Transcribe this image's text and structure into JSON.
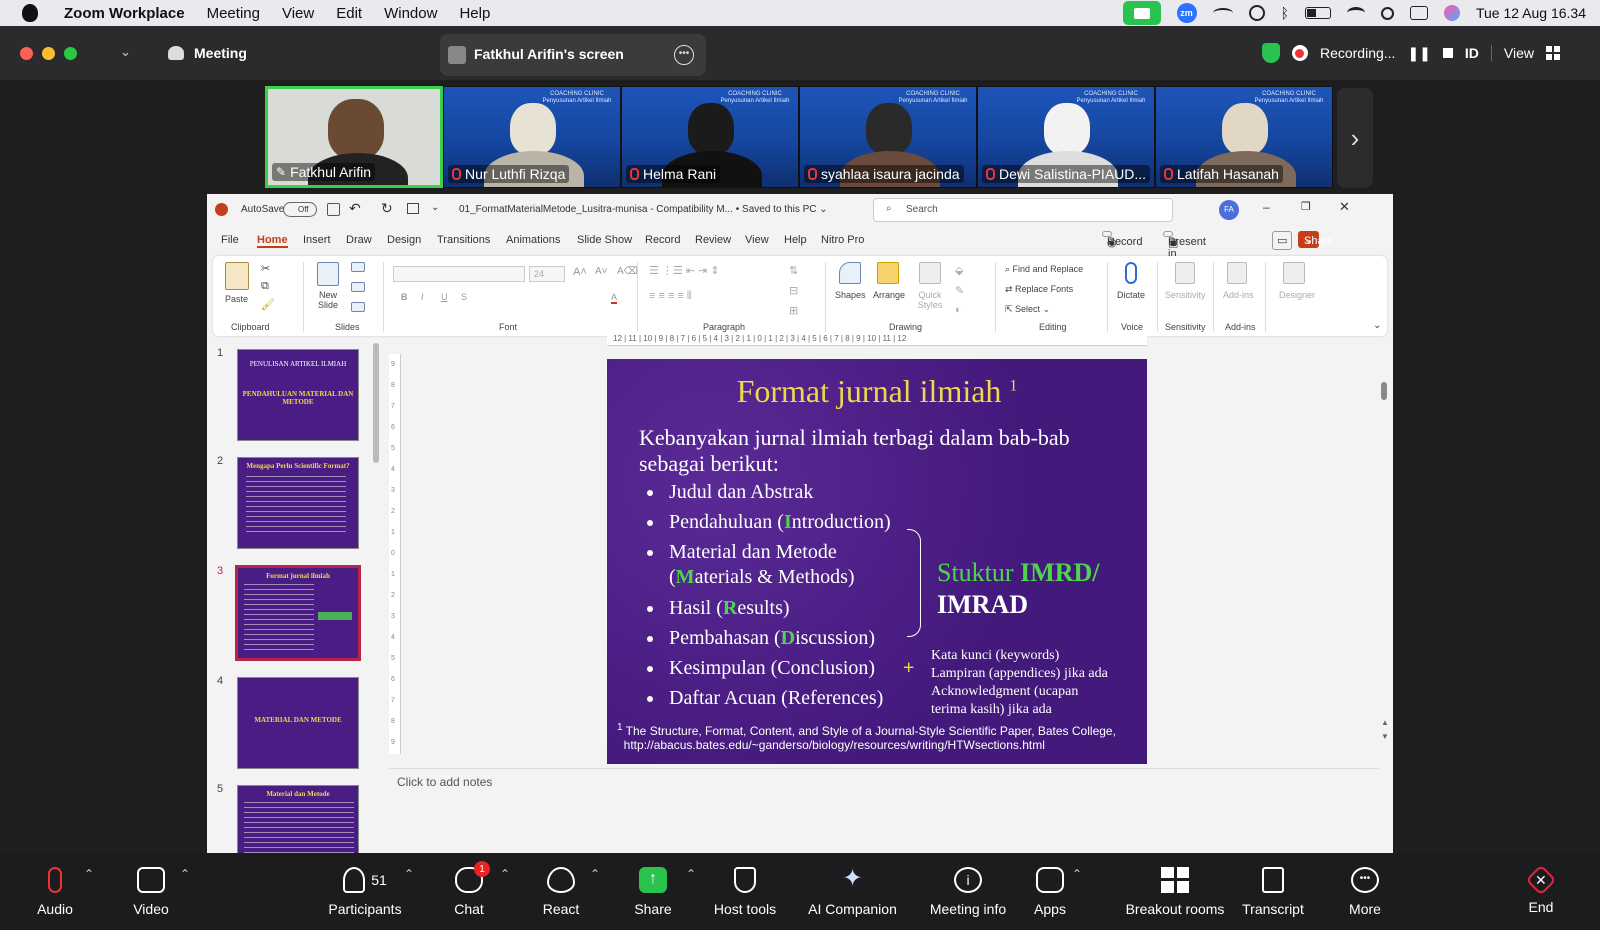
{
  "menubar": {
    "app": "Zoom Workplace",
    "items": [
      "Meeting",
      "View",
      "Edit",
      "Window",
      "Help"
    ],
    "clock": "Tue 12 Aug  16.34",
    "zoom_icon_text": "zm"
  },
  "titlebar": {
    "meeting_label": "Meeting",
    "share_title": "Fatkhul Arifin's screen",
    "recording": "Recording...",
    "id_label": "ID",
    "view_label": "View"
  },
  "participants_strip": {
    "banner_text": "COACHING CLINIC Penyusunan Artikel Ilmiah",
    "tiles": [
      "Fatkhul Arifin",
      "Nur Luthfi Rizqa",
      "Helma Rani",
      "syahlaa isaura jacinda",
      "Dewi Salistina-PIAUD...",
      "Latifah Hasanah"
    ],
    "next_arrow": "›"
  },
  "ppt": {
    "autosave": "AutoSave",
    "autosave_state": "Off",
    "doc_title": "01_FormatMaterialMetode_Lusitra-munisa  -  Compatibility M...  •  Saved to this PC ⌄",
    "search_placeholder": "Search",
    "avatar": "FA",
    "tabs": [
      "File",
      "Home",
      "Insert",
      "Draw",
      "Design",
      "Transitions",
      "Animations",
      "Slide Show",
      "Record",
      "Review",
      "View",
      "Help",
      "Nitro Pro"
    ],
    "record_btn": "Record",
    "present_btn": "Present in Teams",
    "share_btn": "Share",
    "ribbon": {
      "paste": "Paste",
      "new_slide": "New Slide",
      "clipboard": "Clipboard",
      "slides": "Slides",
      "font": "Font",
      "paragraph": "Paragraph",
      "shapes": "Shapes",
      "arrange": "Arrange",
      "quick_styles": "Quick Styles",
      "drawing": "Drawing",
      "find_replace": "Find and Replace",
      "replace_fonts": "Replace Fonts",
      "select": "Select",
      "editing": "Editing",
      "dictate": "Dictate",
      "voice": "Voice",
      "sensitivity": "Sensitivity",
      "addins": "Add-ins",
      "designer": "Designer",
      "font_size": "24",
      "bold": "B",
      "italic": "I",
      "underline": "U",
      "strike": "S",
      "font_color": "A"
    },
    "ruler_h": "12 | 11 | 10 | 9 | 8 | 7 | 6 | 5 | 4 | 3 | 2 | 1 | 0 | 1 | 2 | 3 | 4 | 5 | 6 | 7 | 8 | 9 | 10 | 11 | 12",
    "ruler_v": "9 8 7 6 5 4 3 2 1 0 1 2 3 4 5 6 7 8 9",
    "thumbnails": [
      {
        "num": "1",
        "title": "PENULISAN ARTIKEL ILMIAH",
        "sub": "PENDAHULUAN MATERIAL DAN METODE"
      },
      {
        "num": "2",
        "title": "Mengapa Perlu Scientific Format?",
        "sub": ""
      },
      {
        "num": "3",
        "title": "Format jurnal ilmiah",
        "sub": ""
      },
      {
        "num": "4",
        "title": "MATERIAL DAN METODE",
        "sub": ""
      },
      {
        "num": "5",
        "title": "Material dan Metode",
        "sub": ""
      }
    ],
    "slide": {
      "title": "Format jurnal ilmiah",
      "title_sup": "1",
      "intro": "Kebanyakan jurnal ilmiah terbagi dalam bab-bab sebagai berikut:",
      "bullets": [
        {
          "pre": "Judul dan Abstrak",
          "hl": "",
          "post": ""
        },
        {
          "pre": "Pendahuluan (",
          "hl": "I",
          "post": "ntroduction)"
        },
        {
          "pre": "Material dan Metode",
          "hl": "",
          "post": ""
        },
        {
          "pre": "(",
          "hl": "M",
          "post": "aterials & Methods)"
        },
        {
          "pre": "Hasil (",
          "hl": "R",
          "post": "esults)"
        },
        {
          "pre": "Pembahasan (",
          "hl": "D",
          "post": "iscussion)"
        },
        {
          "pre": "Kesimpulan (Conclusion)",
          "hl": "",
          "post": ""
        },
        {
          "pre": "Daftar Acuan (References)",
          "hl": "",
          "post": ""
        }
      ],
      "imrd_pre": "Stuktur ",
      "imrd_hl": "IMRD/",
      "imrd_line2": "IMRAD",
      "plus": "+",
      "extra": [
        "Kata kunci (keywords)",
        "Lampiran (appendices) jika ada",
        "Acknowledgment (ucapan",
        "terima kasih) jika ada"
      ],
      "foot_sup": "1",
      "foot1": " The Structure, Format, Content, and Style of a Journal-Style Scientific Paper, Bates College,",
      "foot2": "http://abacus.bates.edu/~ganderso/biology/resources/writing/HTWsections.html"
    },
    "notes": "Click to add notes"
  },
  "bottom": {
    "audio": "Audio",
    "video": "Video",
    "participants": "Participants",
    "participants_count": "51",
    "chat": "Chat",
    "chat_badge": "1",
    "react": "React",
    "share": "Share",
    "host_tools": "Host tools",
    "ai": "AI Companion",
    "info": "Meeting info",
    "apps": "Apps",
    "breakout": "Breakout rooms",
    "transcript": "Transcript",
    "more": "More",
    "end": "End"
  },
  "colors": {
    "zoom_green": "#2bc34f",
    "slide_bg": "#4b1f86",
    "slide_title": "#f0d84b",
    "highlight_green": "#4dd64d",
    "end_red": "#e0243a",
    "ppt_share": "#c43e1c"
  }
}
